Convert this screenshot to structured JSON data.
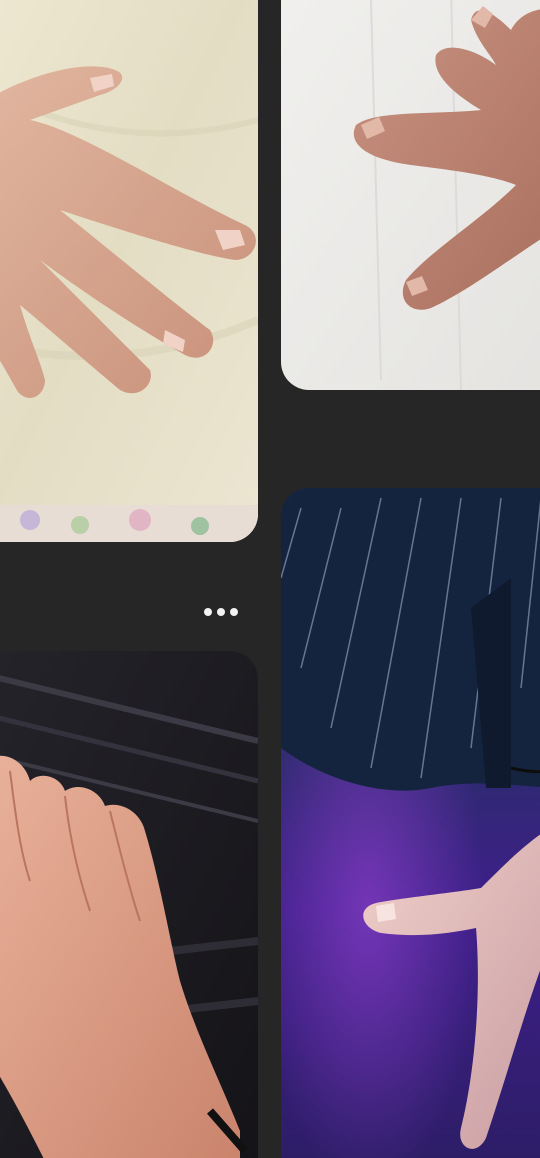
{
  "feed": {
    "pins": [
      {
        "id": "pin-1",
        "image": "hand-photo",
        "background": "#e9e4cf"
      },
      {
        "id": "pin-2",
        "image": "hand-photo",
        "background": "#ecebe8"
      },
      {
        "id": "pin-3",
        "image": "hand-photo",
        "background": "#1c1b20"
      },
      {
        "id": "pin-4",
        "image": "hand-photo",
        "background": "#2a1f5e"
      }
    ],
    "more_button": {
      "icon": "more-horizontal-icon"
    }
  },
  "colors": {
    "page_background": "#262626",
    "icon": "#f2f2f2",
    "skin": "#d9a892"
  }
}
